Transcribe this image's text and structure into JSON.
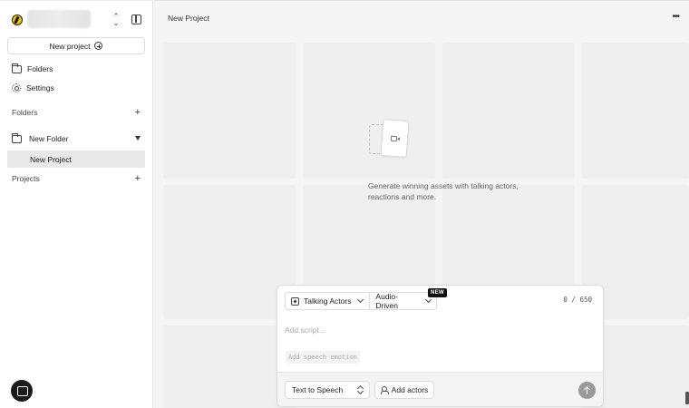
{
  "sidebar": {
    "new_project_label": "New project",
    "nav": [
      {
        "label": "Folders",
        "icon": "folder-icon"
      },
      {
        "label": "Settings",
        "icon": "gear-icon"
      }
    ],
    "folders_heading": "Folders",
    "folder": {
      "label": "New Folder"
    },
    "project": {
      "label": "New Project"
    },
    "projects_heading": "Projects"
  },
  "header": {
    "title": "New Project"
  },
  "empty_state": {
    "line1": "Generate winning assets with talking actors,",
    "line2": "reactions and more."
  },
  "composer": {
    "modes": [
      {
        "label": "Talking Actors"
      },
      {
        "label": "Audio-Driven"
      }
    ],
    "new_badge": "NEW",
    "char_count": "0 / 650",
    "script_placeholder": "Add script...",
    "emotion_chip": "Add speech emotion",
    "voice_source": "Text to Speech",
    "add_actors_label": "Add actors"
  },
  "colors": {
    "background": "#f5f5f5",
    "sidebar_bg": "#ffffff",
    "selected_row": "#e9e9e9",
    "badge_bg": "#111111",
    "submit_disabled": "#9a9a9a",
    "logo_accent": "#f2c200"
  }
}
